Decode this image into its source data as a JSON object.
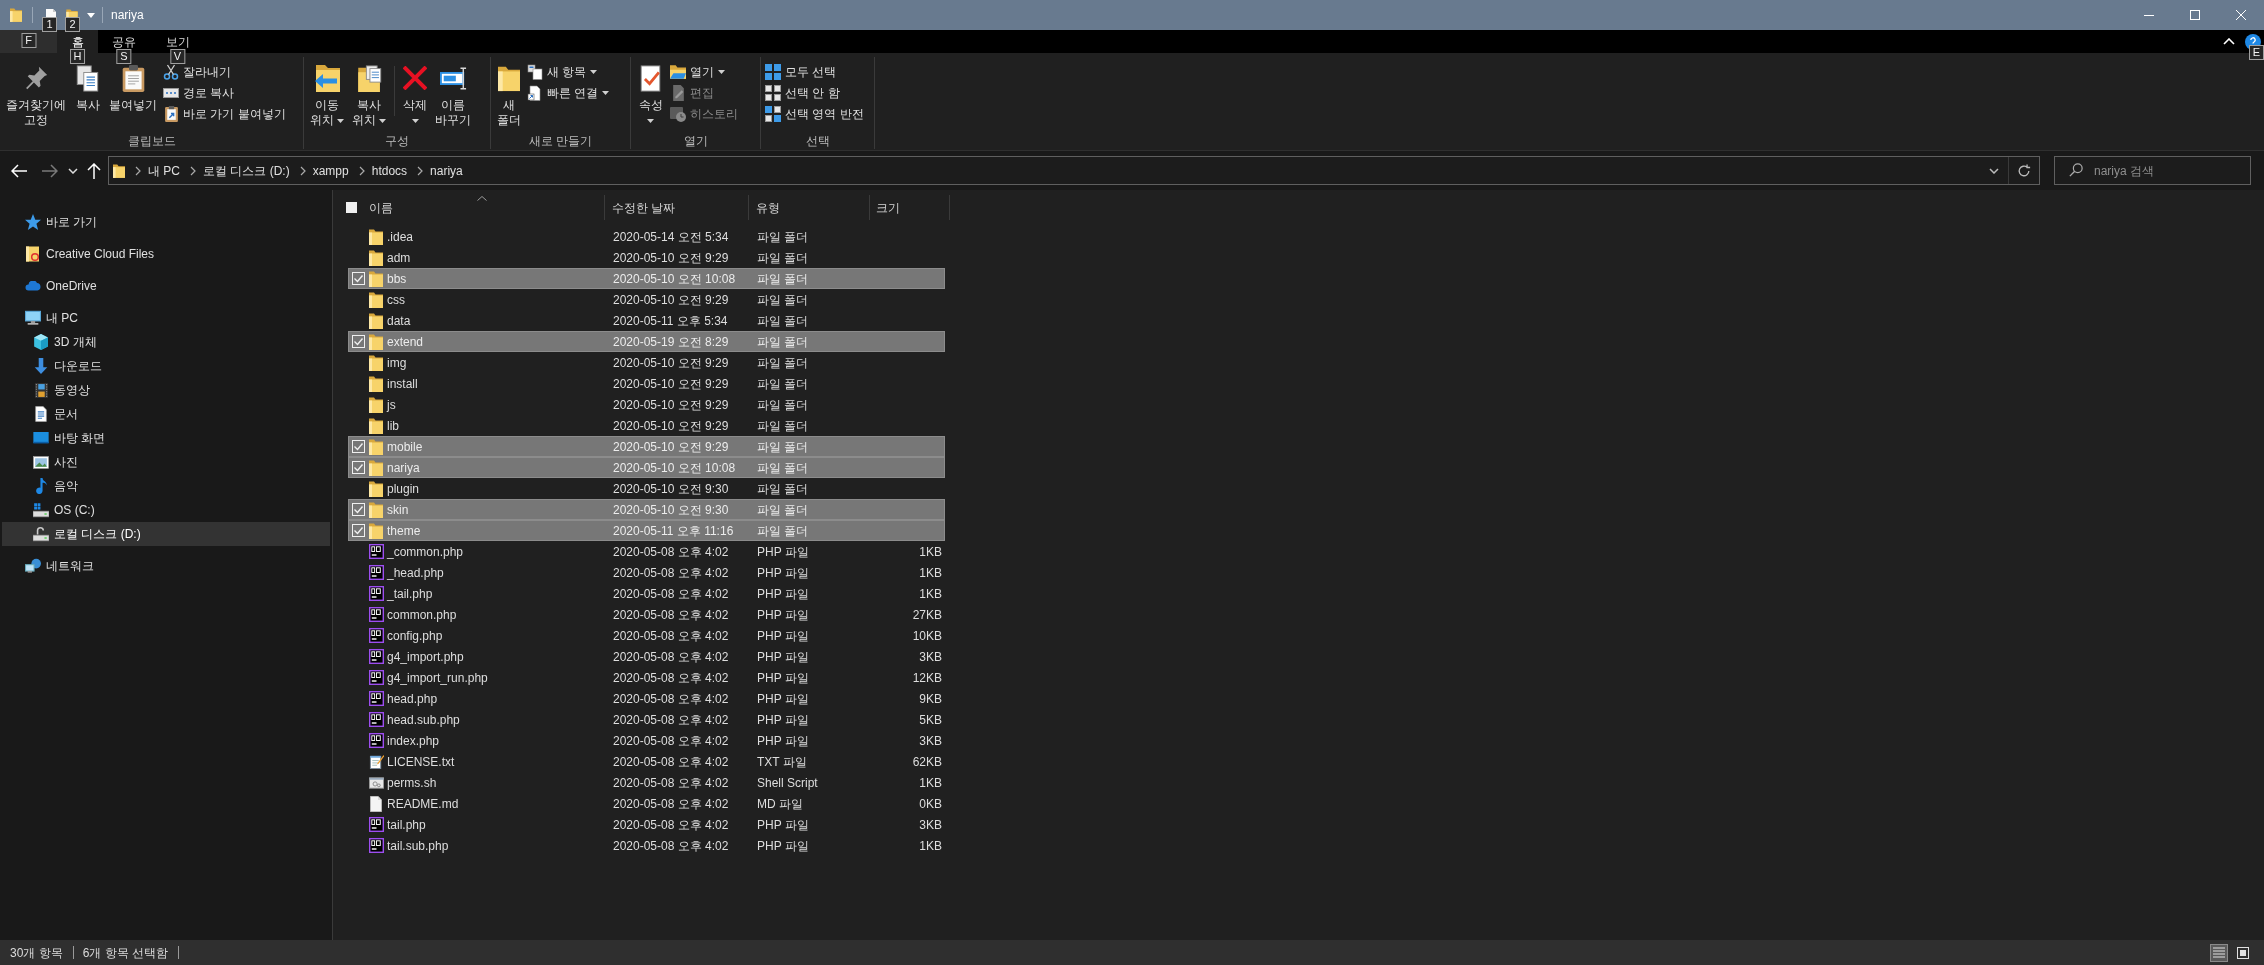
{
  "window": {
    "title": "nariya"
  },
  "quick_access": {
    "keytips": [
      "1",
      "2"
    ]
  },
  "ribbon_tabs": [
    {
      "kind": "menu",
      "keytip": "F",
      "selected": false
    },
    {
      "kind": "tab",
      "label": "홈",
      "keytip": "H",
      "selected": true
    },
    {
      "kind": "tab",
      "label": "공유",
      "keytip": "S",
      "selected": false
    },
    {
      "kind": "tab",
      "label": "보기",
      "keytip": "V",
      "selected": false
    }
  ],
  "help": {
    "keytip": "E"
  },
  "ribbon": {
    "groups": [
      {
        "label": "클립보드",
        "items": [
          {
            "kind": "large",
            "lines": [
              "즐겨찾기에",
              "고정"
            ],
            "dropdown": false
          },
          {
            "kind": "large",
            "lines": [
              "복사"
            ],
            "dropdown": false
          },
          {
            "kind": "large",
            "lines": [
              "붙여넣기"
            ],
            "dropdown": false
          },
          {
            "kind": "stack",
            "items": [
              {
                "label": "잘라내기",
                "dropdown": false,
                "disabled": false
              },
              {
                "label": "경로 복사",
                "dropdown": false,
                "disabled": false
              },
              {
                "label": "바로 가기 붙여넣기",
                "dropdown": false,
                "disabled": false
              }
            ]
          }
        ]
      },
      {
        "label": "구성",
        "items": [
          {
            "kind": "large",
            "lines": [
              "이동",
              "위치"
            ],
            "dropdown": true
          },
          {
            "kind": "large",
            "lines": [
              "복사",
              "위치"
            ],
            "dropdown": true
          },
          {
            "kind": "separator"
          },
          {
            "kind": "large",
            "lines": [
              "삭제"
            ],
            "dropdown": true
          },
          {
            "kind": "large",
            "lines": [
              "이름",
              "바꾸기"
            ],
            "dropdown": false
          }
        ]
      },
      {
        "label": "새로 만들기",
        "items": [
          {
            "kind": "large",
            "lines": [
              "새",
              "폴더"
            ],
            "dropdown": false
          },
          {
            "kind": "stack",
            "items": [
              {
                "label": "새 항목",
                "dropdown": true,
                "disabled": false
              },
              {
                "label": "빠른 연결",
                "dropdown": true,
                "disabled": false
              }
            ]
          }
        ]
      },
      {
        "label": "열기",
        "items": [
          {
            "kind": "large",
            "lines": [
              "속성"
            ],
            "dropdown": true
          },
          {
            "kind": "stack",
            "items": [
              {
                "label": "열기",
                "dropdown": true,
                "disabled": false
              },
              {
                "label": "편집",
                "dropdown": false,
                "disabled": true
              },
              {
                "label": "히스토리",
                "dropdown": false,
                "disabled": true
              }
            ]
          }
        ]
      },
      {
        "label": "선택",
        "items": [
          {
            "kind": "stack",
            "items": [
              {
                "label": "모두 선택",
                "dropdown": false,
                "disabled": false
              },
              {
                "label": "선택 안 함",
                "dropdown": false,
                "disabled": false
              },
              {
                "label": "선택 영역 반전",
                "dropdown": false,
                "disabled": false
              }
            ]
          }
        ]
      }
    ]
  },
  "address_bar": {
    "crumbs": [
      "내 PC",
      "로컬 디스크 (D:)",
      "xampp",
      "htdocs",
      "nariya"
    ]
  },
  "search": {
    "placeholder": "nariya 검색"
  },
  "navigation": {
    "items": [
      {
        "label": "바로 가기",
        "selected": false
      },
      {
        "label": "Creative Cloud Files",
        "selected": false
      },
      {
        "label": "OneDrive",
        "selected": false
      },
      {
        "label": "내 PC",
        "selected": false,
        "children": [
          {
            "label": "3D 개체",
            "selected": false
          },
          {
            "label": "다운로드",
            "selected": false
          },
          {
            "label": "동영상",
            "selected": false
          },
          {
            "label": "문서",
            "selected": false
          },
          {
            "label": "바탕 화면",
            "selected": false
          },
          {
            "label": "사진",
            "selected": false
          },
          {
            "label": "음악",
            "selected": false
          },
          {
            "label": "OS (C:)",
            "selected": false
          },
          {
            "label": "로컬 디스크 (D:)",
            "selected": true
          }
        ]
      },
      {
        "label": "네트워크",
        "selected": false
      }
    ]
  },
  "file_list": {
    "header_checkbox": {
      "indeterminate": true
    },
    "columns": [
      {
        "label": "이름",
        "sorted": true
      },
      {
        "label": "수정한 날짜",
        "sorted": false
      },
      {
        "label": "유형",
        "sorted": false
      },
      {
        "label": "크기",
        "sorted": false
      }
    ],
    "rows": [
      {
        "kind": "folder",
        "name": ".idea",
        "modified": "2020-05-14 오전 5:34",
        "type": "파일 폴더",
        "selected": false
      },
      {
        "kind": "folder",
        "name": "adm",
        "modified": "2020-05-10 오전 9:29",
        "type": "파일 폴더",
        "selected": false
      },
      {
        "kind": "folder",
        "name": "bbs",
        "modified": "2020-05-10 오전 10:08",
        "type": "파일 폴더",
        "selected": true
      },
      {
        "kind": "folder",
        "name": "css",
        "modified": "2020-05-10 오전 9:29",
        "type": "파일 폴더",
        "selected": false
      },
      {
        "kind": "folder",
        "name": "data",
        "modified": "2020-05-11 오후 5:34",
        "type": "파일 폴더",
        "selected": false
      },
      {
        "kind": "folder",
        "name": "extend",
        "modified": "2020-05-19 오전 8:29",
        "type": "파일 폴더",
        "selected": true
      },
      {
        "kind": "folder",
        "name": "img",
        "modified": "2020-05-10 오전 9:29",
        "type": "파일 폴더",
        "selected": false
      },
      {
        "kind": "folder",
        "name": "install",
        "modified": "2020-05-10 오전 9:29",
        "type": "파일 폴더",
        "selected": false
      },
      {
        "kind": "folder",
        "name": "js",
        "modified": "2020-05-10 오전 9:29",
        "type": "파일 폴더",
        "selected": false
      },
      {
        "kind": "folder",
        "name": "lib",
        "modified": "2020-05-10 오전 9:29",
        "type": "파일 폴더",
        "selected": false
      },
      {
        "kind": "folder",
        "name": "mobile",
        "modified": "2020-05-10 오전 9:29",
        "type": "파일 폴더",
        "selected": true
      },
      {
        "kind": "folder",
        "name": "nariya",
        "modified": "2020-05-10 오전 10:08",
        "type": "파일 폴더",
        "selected": true
      },
      {
        "kind": "folder",
        "name": "plugin",
        "modified": "2020-05-10 오전 9:30",
        "type": "파일 폴더",
        "selected": false
      },
      {
        "kind": "folder",
        "name": "skin",
        "modified": "2020-05-10 오전 9:30",
        "type": "파일 폴더",
        "selected": true
      },
      {
        "kind": "folder",
        "name": "theme",
        "modified": "2020-05-11 오후 11:16",
        "type": "파일 폴더",
        "selected": true
      },
      {
        "kind": "php",
        "name": "_common.php",
        "modified": "2020-05-08 오후 4:02",
        "type": "PHP 파일",
        "size": "1KB",
        "selected": false
      },
      {
        "kind": "php",
        "name": "_head.php",
        "modified": "2020-05-08 오후 4:02",
        "type": "PHP 파일",
        "size": "1KB",
        "selected": false
      },
      {
        "kind": "php",
        "name": "_tail.php",
        "modified": "2020-05-08 오후 4:02",
        "type": "PHP 파일",
        "size": "1KB",
        "selected": false
      },
      {
        "kind": "php",
        "name": "common.php",
        "modified": "2020-05-08 오후 4:02",
        "type": "PHP 파일",
        "size": "27KB",
        "selected": false
      },
      {
        "kind": "php",
        "name": "config.php",
        "modified": "2020-05-08 오후 4:02",
        "type": "PHP 파일",
        "size": "10KB",
        "selected": false
      },
      {
        "kind": "php",
        "name": "g4_import.php",
        "modified": "2020-05-08 오후 4:02",
        "type": "PHP 파일",
        "size": "3KB",
        "selected": false
      },
      {
        "kind": "php",
        "name": "g4_import_run.php",
        "modified": "2020-05-08 오후 4:02",
        "type": "PHP 파일",
        "size": "12KB",
        "selected": false
      },
      {
        "kind": "php",
        "name": "head.php",
        "modified": "2020-05-08 오후 4:02",
        "type": "PHP 파일",
        "size": "9KB",
        "selected": false
      },
      {
        "kind": "php",
        "name": "head.sub.php",
        "modified": "2020-05-08 오후 4:02",
        "type": "PHP 파일",
        "size": "5KB",
        "selected": false
      },
      {
        "kind": "php",
        "name": "index.php",
        "modified": "2020-05-08 오후 4:02",
        "type": "PHP 파일",
        "size": "3KB",
        "selected": false
      },
      {
        "kind": "txt",
        "name": "LICENSE.txt",
        "modified": "2020-05-08 오후 4:02",
        "type": "TXT 파일",
        "size": "62KB",
        "selected": false
      },
      {
        "kind": "shell",
        "name": "perms.sh",
        "modified": "2020-05-08 오후 4:02",
        "type": "Shell Script",
        "size": "1KB",
        "selected": false
      },
      {
        "kind": "md",
        "name": "README.md",
        "modified": "2020-05-08 오후 4:02",
        "type": "MD 파일",
        "size": "0KB",
        "selected": false
      },
      {
        "kind": "php",
        "name": "tail.php",
        "modified": "2020-05-08 오후 4:02",
        "type": "PHP 파일",
        "size": "3KB",
        "selected": false
      },
      {
        "kind": "php",
        "name": "tail.sub.php",
        "modified": "2020-05-08 오후 4:02",
        "type": "PHP 파일",
        "size": "1KB",
        "selected": false
      }
    ]
  },
  "status_bar": {
    "item_count": "30개 항목",
    "selection": "6개 항목 선택함",
    "view_buttons": [
      {
        "selected": true
      },
      {
        "selected": false
      }
    ]
  }
}
